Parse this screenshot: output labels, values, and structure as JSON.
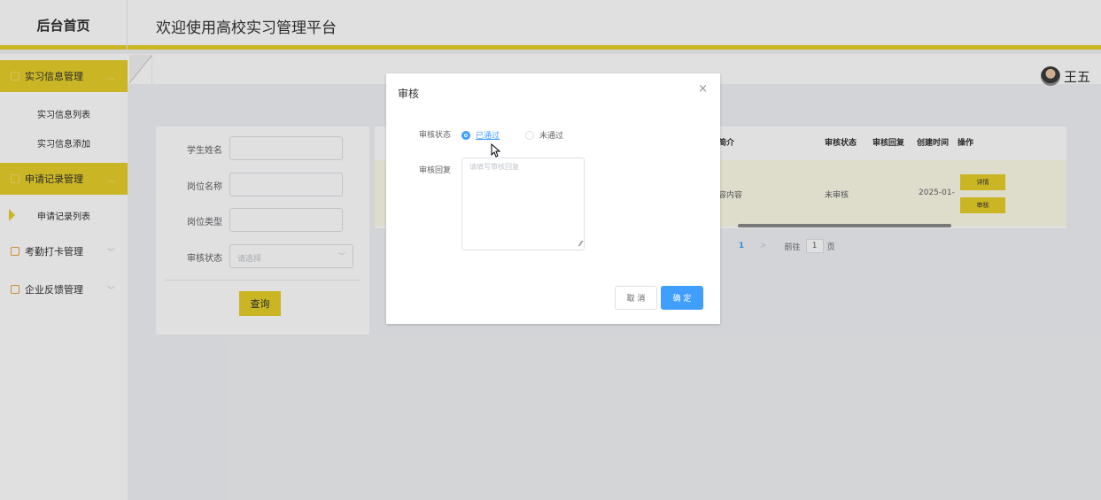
{
  "header": {
    "logo": "后台首页",
    "welcome": "欢迎使用高校实习管理平台"
  },
  "user": {
    "name": "王五"
  },
  "sidebar": {
    "groups": [
      {
        "label": "实习信息管理",
        "items": [
          "实习信息列表",
          "实习信息添加"
        ]
      },
      {
        "label": "申请记录管理",
        "items": [
          "申请记录列表"
        ]
      },
      {
        "label": "考勤打卡管理"
      },
      {
        "label": "企业反馈管理"
      }
    ]
  },
  "search": {
    "student_name_label": "学生姓名",
    "position_name_label": "岗位名称",
    "position_type_label": "岗位类型",
    "status_label": "审核状态",
    "status_placeholder": "请选择",
    "query_button": "查询"
  },
  "table": {
    "columns": [
      "简介",
      "审核状态",
      "审核回复",
      "创建时间",
      "操作"
    ],
    "rows": [
      {
        "intro": "容内容",
        "status": "未审核",
        "reply": "",
        "created": "2025-01-",
        "actions": [
          "详情",
          "审核"
        ]
      }
    ]
  },
  "pagination": {
    "current": "1",
    "goto_label": "前往",
    "goto_value": "1",
    "page_suffix": "页"
  },
  "dialog": {
    "title": "审核",
    "status_label": "审核状态",
    "option_pass": "已通过",
    "option_fail": "未通过",
    "selected": "已通过",
    "reply_label": "审核回复",
    "reply_placeholder": "请填写审核回复",
    "cancel": "取 消",
    "confirm": "确 定"
  },
  "colors": {
    "accent": "#e6cf2a",
    "primary": "#409eff"
  }
}
